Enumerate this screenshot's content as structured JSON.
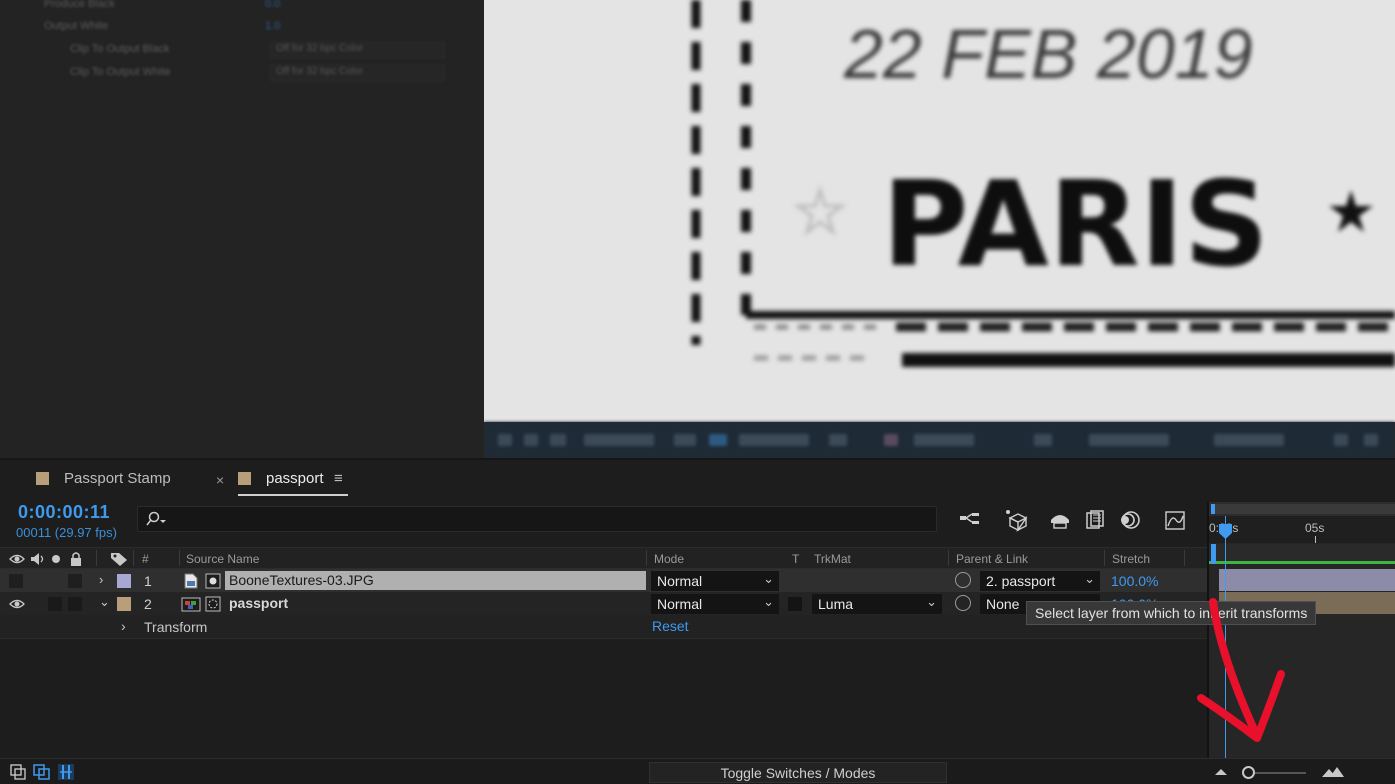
{
  "effects_panel": {
    "rows": [
      {
        "label": "Produce Black",
        "value": "0.0"
      },
      {
        "label": "Output White",
        "value": "1.0"
      },
      {
        "label": "Clip To Output Black",
        "value": "Off for 32 bpc Color"
      },
      {
        "label": "Clip To Output White",
        "value": "Off for 32 bpc Color"
      }
    ]
  },
  "viewer": {
    "stamp_date": "22 FEB 2019",
    "stamp_city": "PARIS"
  },
  "tabs": [
    {
      "label": "Passport Stamp"
    },
    {
      "label": "passport",
      "close": "×",
      "menu": "≡"
    }
  ],
  "timecode": {
    "time": "0:00:00:11",
    "frames": "00011 (29.97 fps)"
  },
  "columns": {
    "hash": "#",
    "source_name": "Source Name",
    "mode": "Mode",
    "t": "T",
    "trkmat": "TrkMat",
    "parent": "Parent & Link",
    "stretch": "Stretch"
  },
  "layers": [
    {
      "num": "1",
      "name": "BooneTextures-03.JPG",
      "mode": "Normal",
      "trkmat": "",
      "parent": "2. passport",
      "stretch": "100.0%",
      "label_color": "#a7a7d4"
    },
    {
      "num": "2",
      "name": "passport",
      "mode": "Normal",
      "trkmat": "Luma",
      "parent": "None",
      "stretch": "100.0%",
      "label_color": "#b89f7a"
    }
  ],
  "transform": {
    "label": "Transform",
    "reset": "Reset"
  },
  "tooltip": "Select layer from which to inherit transforms",
  "ruler": {
    "start": "0:00s",
    "mark": "05s"
  },
  "bottom": {
    "toggle": "Toggle Switches / Modes"
  },
  "colors": {
    "accent": "#3f9af0",
    "selection": "#b0b0b0",
    "arrow": "#e8102a",
    "work_area": "#3fb53f"
  }
}
